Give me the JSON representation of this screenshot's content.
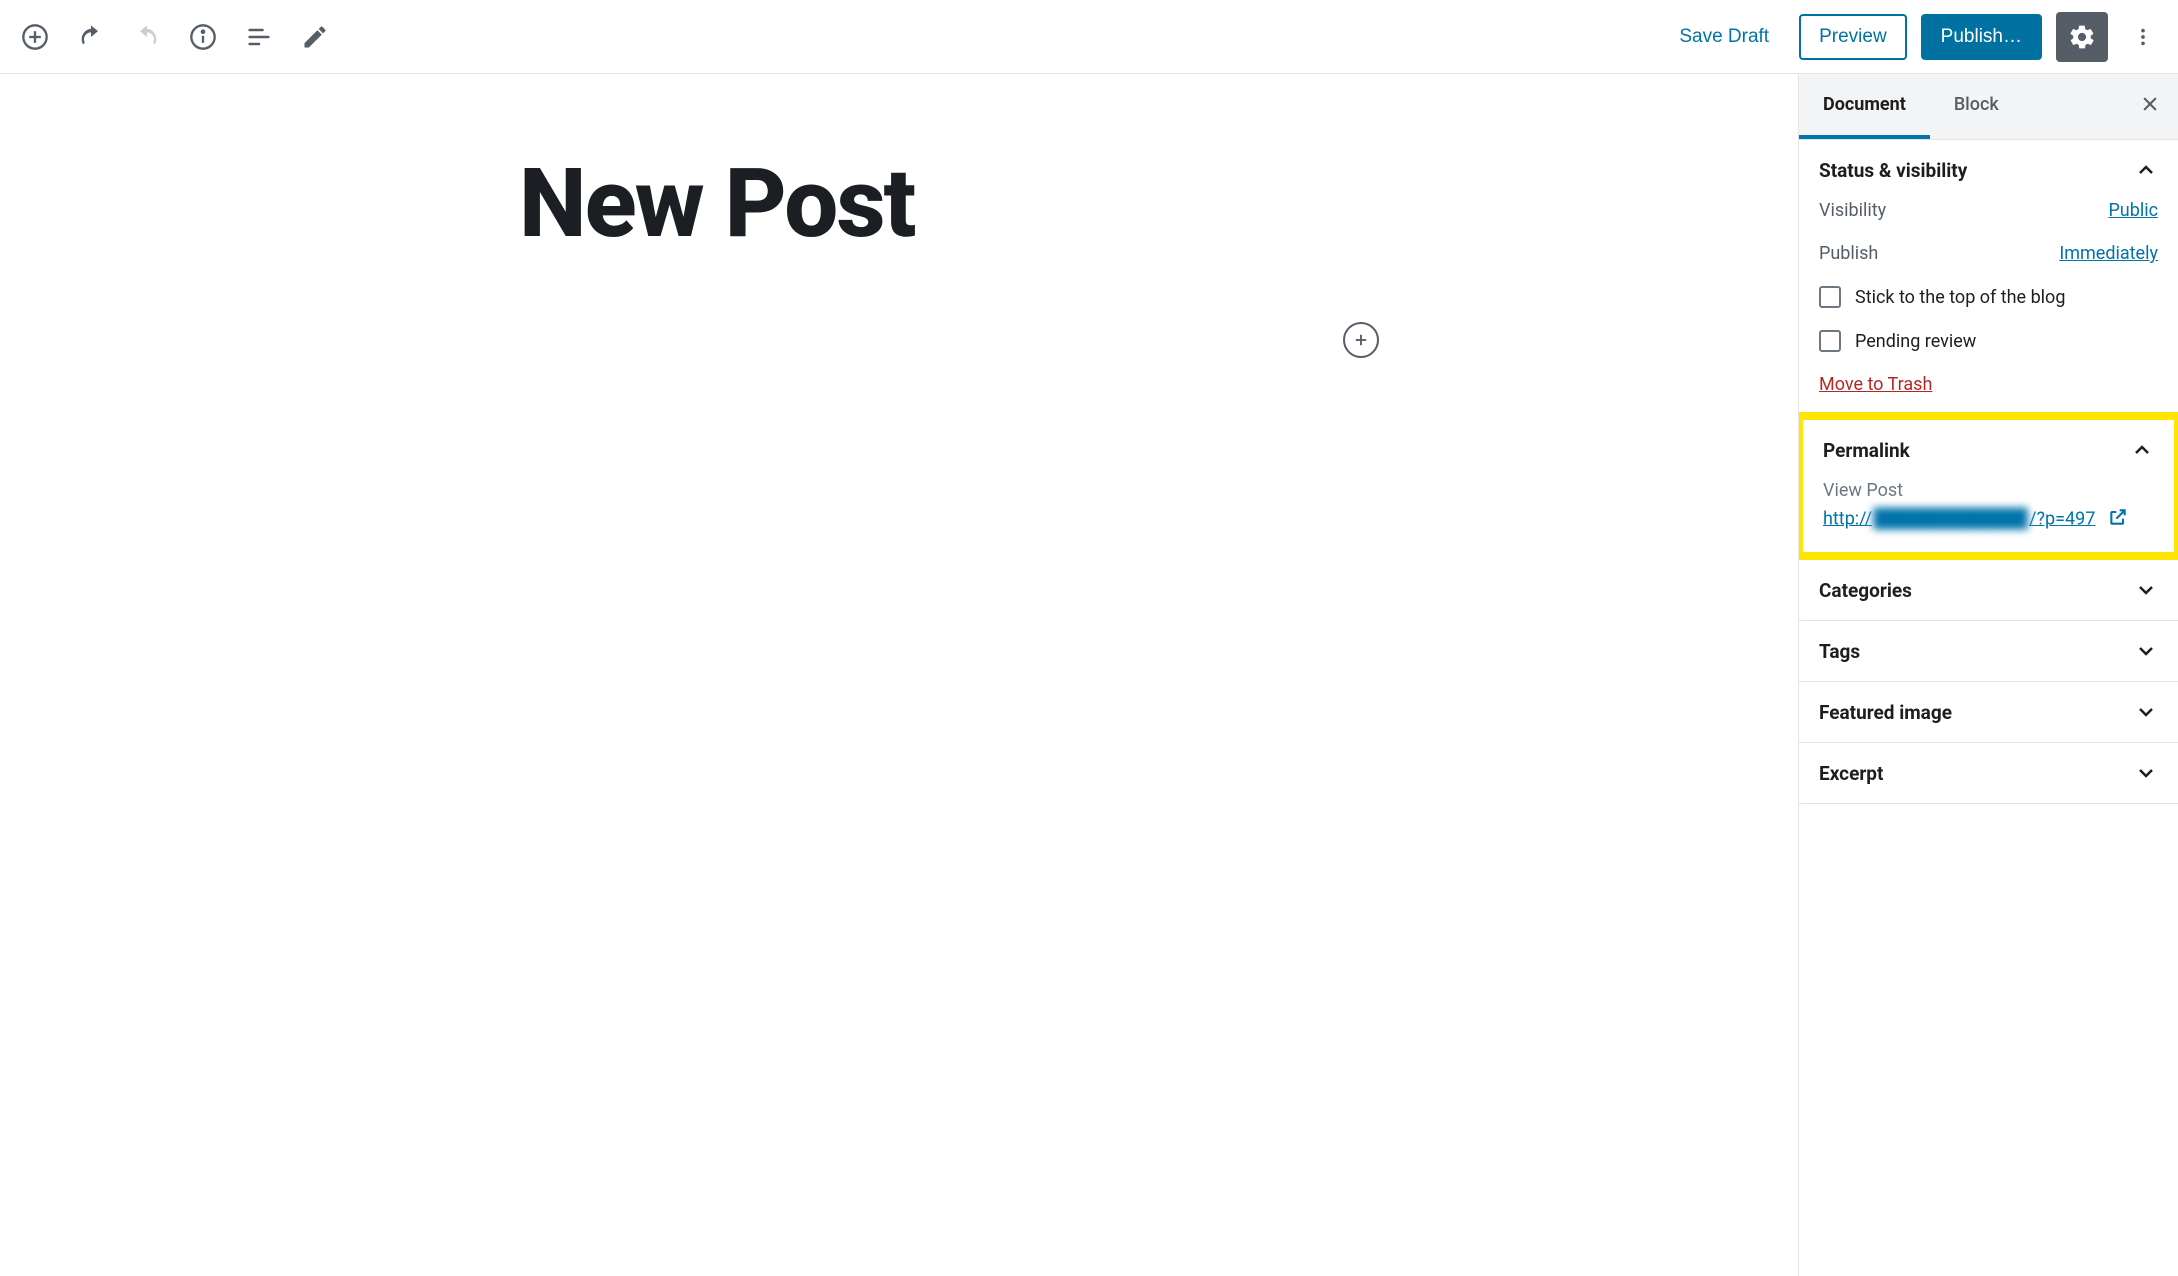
{
  "toolbar": {
    "save_draft": "Save Draft",
    "preview": "Preview",
    "publish": "Publish…"
  },
  "editor": {
    "title": "New Post"
  },
  "sidebar": {
    "tabs": {
      "document": "Document",
      "block": "Block"
    },
    "status": {
      "title": "Status & visibility",
      "visibility_label": "Visibility",
      "visibility_value": "Public",
      "publish_label": "Publish",
      "publish_value": "Immediately",
      "sticky": "Stick to the top of the blog",
      "pending": "Pending review",
      "trash": "Move to Trash"
    },
    "permalink": {
      "title": "Permalink",
      "view_label": "View Post",
      "url_prefix": "http://",
      "url_blur": "████████████",
      "url_suffix": "/?p=497"
    },
    "categories": {
      "title": "Categories"
    },
    "tags": {
      "title": "Tags"
    },
    "featured": {
      "title": "Featured image"
    },
    "excerpt": {
      "title": "Excerpt"
    }
  }
}
